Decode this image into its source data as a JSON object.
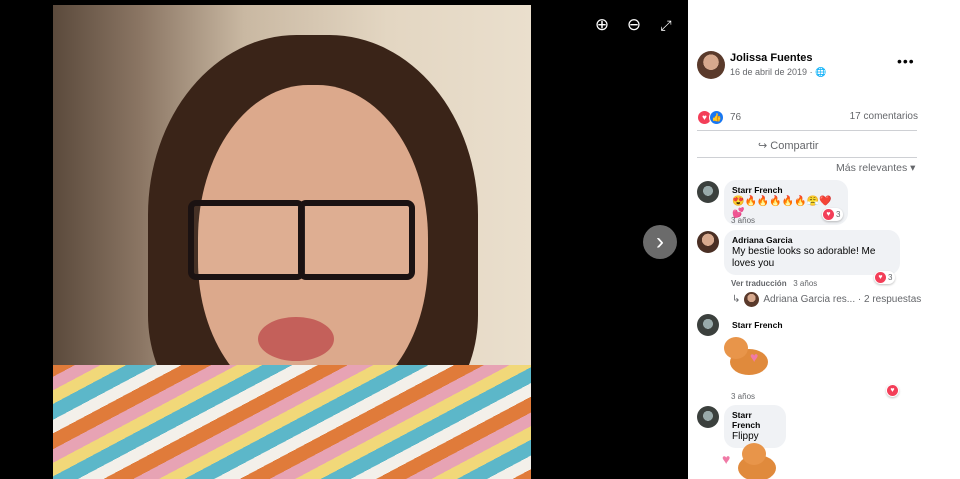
{
  "viewer": {
    "tools": [
      "zoom-in-icon",
      "zoom-out-icon",
      "fullscreen-icon"
    ],
    "next_icon": "chevron-right-icon"
  },
  "post": {
    "author": "Jolissa Fuentes",
    "date": "16 de abril de 2019",
    "privacy_icon": "globe-icon",
    "more_icon": "more-horizontal-icon",
    "reaction_count": "76",
    "comments_count": "17 comentarios",
    "share_label": "Compartir",
    "sort_label": "Más relevantes"
  },
  "comments": [
    {
      "author": "Starr French",
      "text": "😍🔥🔥🔥🔥🔥😤❤️💕",
      "time": "3 años",
      "reactions": "3"
    },
    {
      "author": "Adriana Garcia",
      "text": "My bestie looks so adorable! Me loves you",
      "translate": "Ver traducción",
      "time": "3 años",
      "reactions": "3",
      "reply_author": "Adriana Garcia res...",
      "reply_count": "· 2 respuestas"
    },
    {
      "author": "Starr French",
      "sticker": "corgi-heart-sticker",
      "time": "3 años"
    },
    {
      "author": "Starr French",
      "text": "Flippy",
      "sticker": "corgi-sticker"
    }
  ],
  "colors": {
    "love": "#f33e58",
    "like": "#1877f2",
    "muted_text": "#65676b",
    "bubble": "#f0f2f5"
  }
}
